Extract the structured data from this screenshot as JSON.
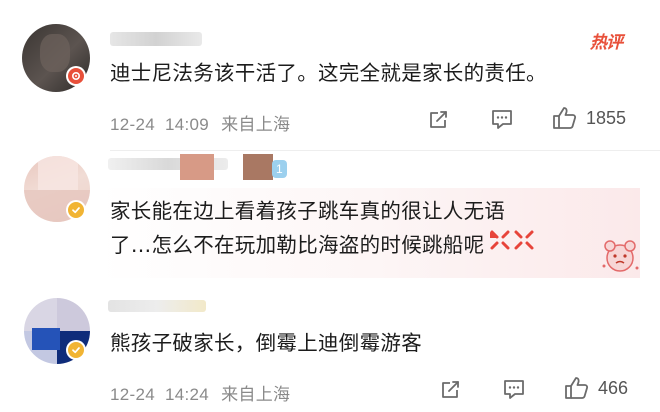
{
  "colors": {
    "accent_red": "#e8503a",
    "verified_gold": "#f1b434",
    "meta_gray": "#8a8a8a",
    "icon_gray": "#6b6b6b",
    "highlight_bg": "#fdf0f0"
  },
  "comments": [
    {
      "text": "迪士尼法务该干活了。这完全就是家长的责任。",
      "date": "12-24",
      "time": "14:09",
      "location": "来自上海",
      "likes": "1855",
      "tag": "热评",
      "badge_icon": "gear-icon"
    },
    {
      "text_line1": "家长能在边上看着孩子跳车真的很让人无语",
      "text_line2": "了…怎么不在玩加勒比海盗的时候跳船呢",
      "badge_icon": "verified-icon",
      "name_suffix": "1"
    },
    {
      "text": "熊孩子破家长，倒霉上迪倒霉游客",
      "date": "12-24",
      "time": "14:24",
      "location": "来自上海",
      "likes": "466",
      "badge_icon": "verified-icon"
    }
  ]
}
